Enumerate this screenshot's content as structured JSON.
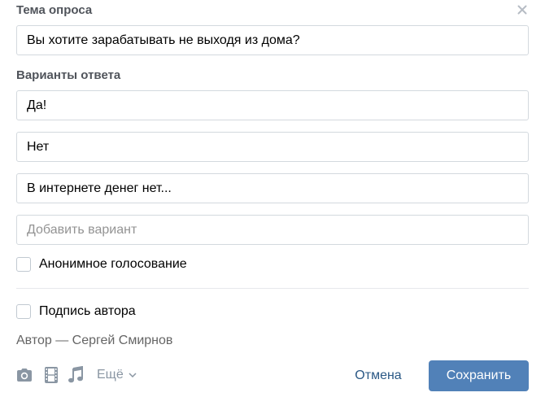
{
  "poll": {
    "topic_label": "Тема опроса",
    "topic_value": "Вы хотите зарабатывать не выходя из дома?",
    "options_label": "Варианты ответа",
    "options": [
      {
        "value": "Да!"
      },
      {
        "value": "Нет"
      },
      {
        "value": "В интернете денег нет..."
      }
    ],
    "add_option_placeholder": "Добавить вариант",
    "anonymous_label": "Анонимное голосование",
    "anonymous_checked": false,
    "signature_label": "Подпись автора",
    "signature_checked": false,
    "author_text": "Автор — Сергей Смирнов"
  },
  "toolbar": {
    "icons": [
      "camera-icon",
      "film-icon",
      "music-note-icon"
    ],
    "more_label": "Ещё",
    "cancel_label": "Отмена",
    "save_label": "Сохранить"
  },
  "colors": {
    "accent": "#5181b8",
    "link": "#2a5885",
    "muted_icon": "#8a96a3",
    "border": "#d3d9de"
  }
}
